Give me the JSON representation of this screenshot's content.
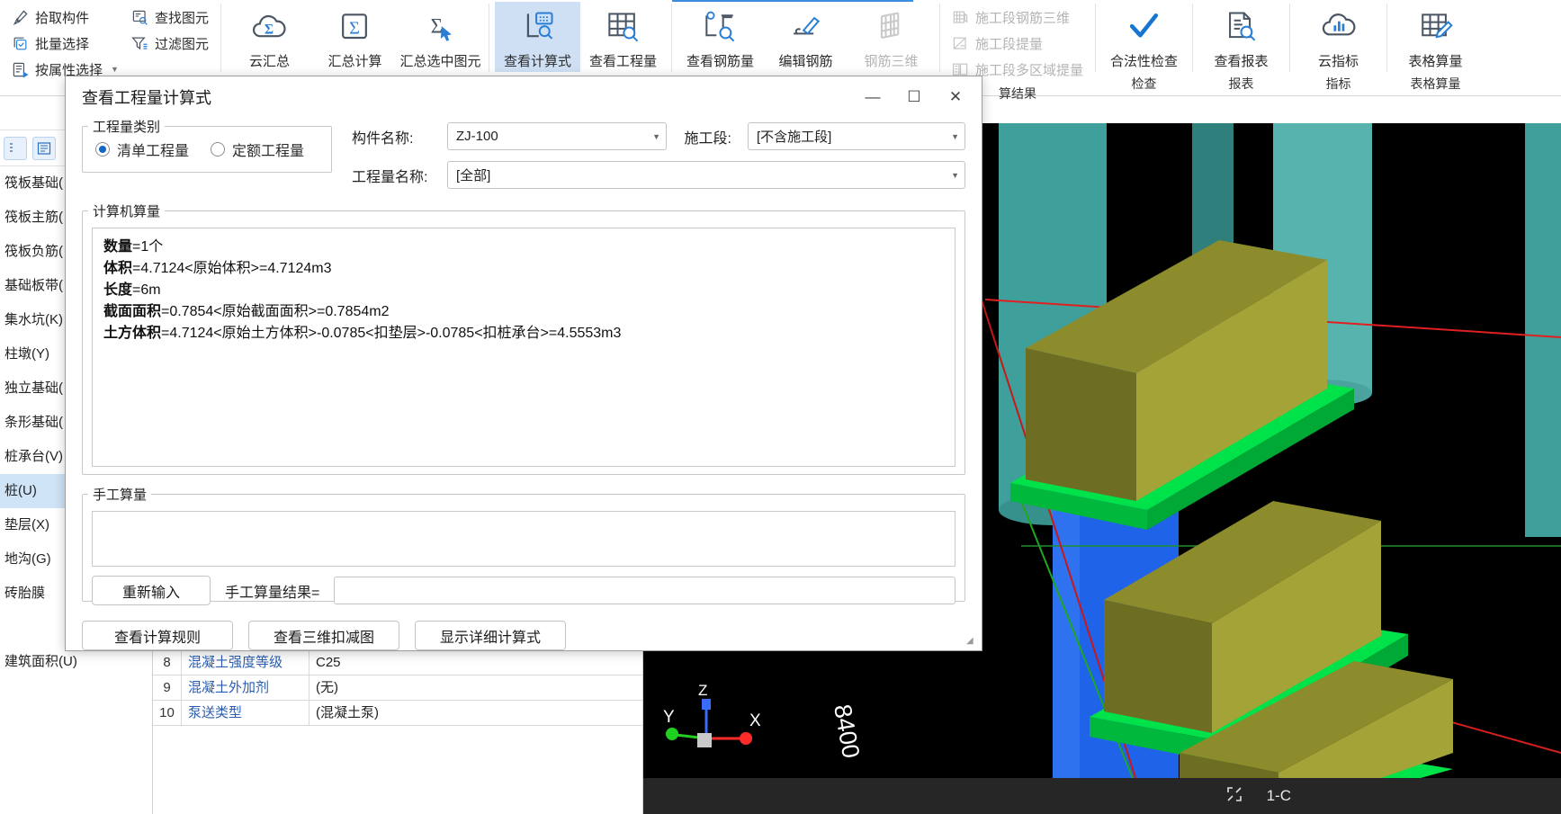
{
  "ribbon": {
    "select_group": {
      "items": [
        {
          "label": "拾取构件",
          "icon": "pick-element-icon",
          "dim": false,
          "caret": false
        },
        {
          "label": "批量选择",
          "icon": "batch-select-icon",
          "dim": false,
          "caret": false
        },
        {
          "label": "按属性选择",
          "icon": "select-by-property-icon",
          "dim": false,
          "caret": true
        }
      ]
    },
    "find_group": {
      "items": [
        {
          "label": "查找图元",
          "icon": "find-element-icon",
          "dim": false,
          "caret": false
        },
        {
          "label": "过滤图元",
          "icon": "filter-element-icon",
          "dim": false,
          "caret": false
        }
      ]
    },
    "summary_buttons": [
      {
        "label": "云汇总",
        "icon": "cloud-sum-icon",
        "selected": false,
        "dim": false
      },
      {
        "label": "汇总计算",
        "icon": "sigma-box-icon",
        "selected": false,
        "dim": false
      },
      {
        "label": "汇总选中图元",
        "icon": "sigma-cursor-icon",
        "selected": false,
        "dim": false
      }
    ],
    "view_buttons": [
      {
        "label": "查看计算式",
        "icon": "view-formula-icon",
        "selected": true,
        "dim": false
      },
      {
        "label": "查看工程量",
        "icon": "view-quantity-icon",
        "selected": false,
        "dim": false
      }
    ],
    "rebar_buttons": [
      {
        "label": "查看钢筋量",
        "icon": "view-rebar-qty-icon",
        "selected": false,
        "dim": false
      },
      {
        "label": "编辑钢筋",
        "icon": "edit-rebar-icon",
        "selected": false,
        "dim": false
      },
      {
        "label": "钢筋三维",
        "icon": "rebar-3d-icon",
        "selected": false,
        "dim": true
      }
    ],
    "section_group": {
      "items": [
        {
          "label": "施工段钢筋三维",
          "icon": "section-rebar-3d-icon",
          "dim": true,
          "caret": false
        },
        {
          "label": "施工段提量",
          "icon": "section-extract-icon",
          "dim": true,
          "caret": false
        },
        {
          "label": "施工段多区域提量",
          "icon": "section-multizone-icon",
          "dim": true,
          "caret": false
        }
      ]
    },
    "tail_buttons": [
      {
        "label": "合法性检查",
        "icon": "check-mark-icon",
        "selected": false,
        "dim": false
      },
      {
        "label": "查看报表",
        "icon": "view-report-icon",
        "selected": false,
        "dim": false
      },
      {
        "label": "云指标",
        "icon": "cloud-metrics-icon",
        "selected": false,
        "dim": false
      },
      {
        "label": "表格算量",
        "icon": "table-calc-icon",
        "selected": false,
        "dim": false
      }
    ],
    "group_labels": [
      {
        "label": "算结果"
      },
      {
        "label": "检查"
      },
      {
        "label": "报表"
      },
      {
        "label": "指标"
      },
      {
        "label": "表格算量"
      }
    ]
  },
  "left_panel": {
    "toolbar_icons": [
      "list-view-icon",
      "detail-view-icon"
    ],
    "items": [
      {
        "label": "筏板基础("
      },
      {
        "label": "筏板主筋("
      },
      {
        "label": "筏板负筋("
      },
      {
        "label": "基础板带("
      },
      {
        "label": "集水坑(K)"
      },
      {
        "label": "柱墩(Y)"
      },
      {
        "label": "独立基础("
      },
      {
        "label": "条形基础("
      },
      {
        "label": "桩承台(V)"
      },
      {
        "label": "桩(U)"
      },
      {
        "label": "垫层(X)"
      },
      {
        "label": "地沟(G)"
      },
      {
        "label": "砖胎膜"
      },
      {
        "label": ""
      },
      {
        "label": "建筑面积(U)"
      }
    ],
    "active_index": 9
  },
  "property_table": {
    "rows": [
      {
        "num": "8",
        "name": "混凝土强度等级",
        "value": "C25"
      },
      {
        "num": "9",
        "name": "混凝土外加剂",
        "value": "(无)"
      },
      {
        "num": "10",
        "name": "泵送类型",
        "value": "(混凝土泵)"
      }
    ]
  },
  "viewport": {
    "axis_labels": {
      "x": "X",
      "y": "Y",
      "z": "Z"
    },
    "dimension_label": "8400",
    "status_left_icon": "fit-view-icon",
    "status_text": "1-C"
  },
  "dialog": {
    "title": "查看工程量计算式",
    "window_buttons": {
      "minimize": "—",
      "maximize": "☐",
      "close": "✕"
    },
    "quantity_category": {
      "legend": "工程量类别",
      "options": [
        {
          "label": "清单工程量",
          "selected": true
        },
        {
          "label": "定额工程量",
          "selected": false
        }
      ]
    },
    "fields": {
      "component_name_label": "构件名称:",
      "component_name_value": "ZJ-100",
      "section_label": "施工段:",
      "section_value": "[不含施工段]",
      "quantity_name_label": "工程量名称:",
      "quantity_name_value": "[全部]"
    },
    "computer_calc": {
      "legend": "计算机算量",
      "lines": [
        {
          "name": "数量",
          "expr": "=1个"
        },
        {
          "name": "体积",
          "expr": "=4.7124<原始体积>=4.7124m3"
        },
        {
          "name": "长度",
          "expr": "=6m"
        },
        {
          "name": "截面面积",
          "expr": "=0.7854<原始截面面积>=0.7854m2"
        },
        {
          "name": "土方体积",
          "expr": "=4.7124<原始土方体积>-0.0785<扣垫层>-0.0785<扣桩承台>=4.5553m3"
        }
      ]
    },
    "manual_calc": {
      "legend": "手工算量",
      "textarea_value": "",
      "reinput_button": "重新输入",
      "result_label": "手工算量结果=",
      "result_value": ""
    },
    "footer_buttons": [
      {
        "label": "查看计算规则"
      },
      {
        "label": "查看三维扣减图"
      },
      {
        "label": "显示详细计算式"
      }
    ]
  },
  "colors": {
    "accent": "#1268c3",
    "selected_bg": "#cfe0f4",
    "nav_active_bg": "#cfe4f7",
    "link_text": "#2a5db0",
    "dim_text": "#b4b4b4"
  }
}
